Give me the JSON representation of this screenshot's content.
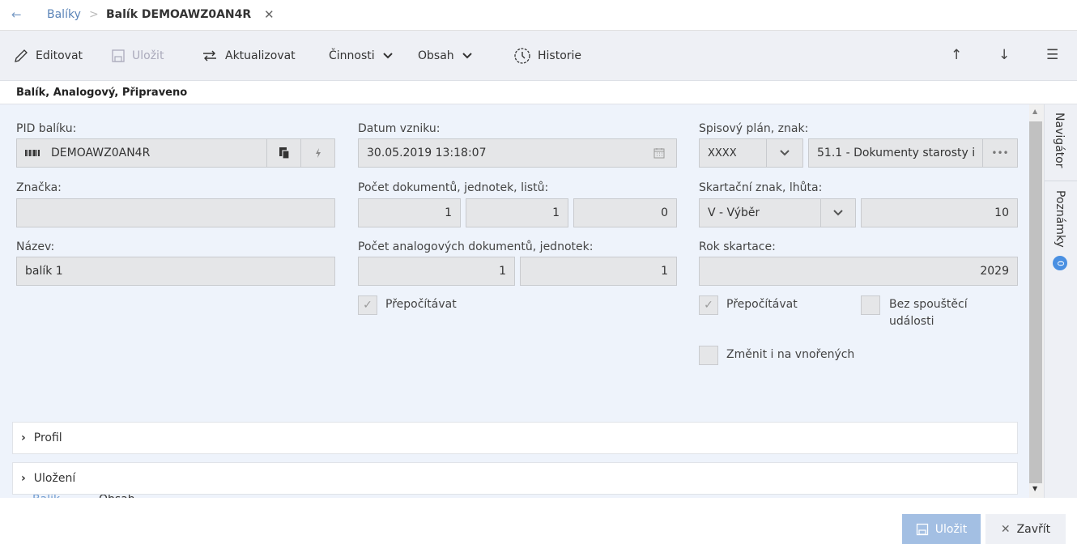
{
  "breadcrumb": {
    "back_icon": "←",
    "parent": "Balíky",
    "separator": ">",
    "current": "Balík DEMOAWZ0AN4R",
    "close_icon": "✕"
  },
  "toolbar": {
    "edit": "Editovat",
    "save": "Uložit",
    "refresh": "Aktualizovat",
    "activities": "Činnosti",
    "content": "Obsah",
    "history": "Historie",
    "up_icon": "↑",
    "down_icon": "↓",
    "menu_icon": "☰"
  },
  "status": "Balík, Analogový, Připraveno",
  "fields": {
    "pid_label": "PID balíku:",
    "pid_value": "DEMOAWZ0AN4R",
    "date_label": "Datum vzniku:",
    "date_value": "30.05.2019 13:18:07",
    "plan_label": "Spisový plán, znak:",
    "plan_select": "XXXX",
    "plan_value": "51.1 - Dokumenty starosty i",
    "mark_label": "Značka:",
    "mark_value": "",
    "count_label": "Počet dokumentů, jednotek, listů:",
    "count_docs": "1",
    "count_units": "1",
    "count_sheets": "0",
    "shred_label": "Skartační znak, lhůta:",
    "shred_select": "V - Výběr",
    "shred_period": "10",
    "name_label": "Název:",
    "name_value": "balík 1",
    "analog_label": "Počet analogových dokumentů, jednotek:",
    "analog_docs": "1",
    "analog_units": "1",
    "year_label": "Rok skartace:",
    "year_value": "2029",
    "recalc_label": "Přepočítávat",
    "recalc2_label": "Přepočítávat",
    "notrigger_label_1": "Bez spouštěcí",
    "notrigger_label_2": "události",
    "nested_label": "Změnit i na vnořených"
  },
  "tabs": [
    "Balík",
    "Obsah"
  ],
  "sections": [
    "Profil",
    "Uložení"
  ],
  "side": {
    "navigator": "Navigátor",
    "notes": "Poznámky",
    "notes_count": "0"
  },
  "footer": {
    "save": "Uložit",
    "close": "Zavřít"
  },
  "colors": {
    "accent": "#6f9bd0",
    "form_bg": "#eef3fb",
    "save_btn": "#a3bfe3"
  }
}
